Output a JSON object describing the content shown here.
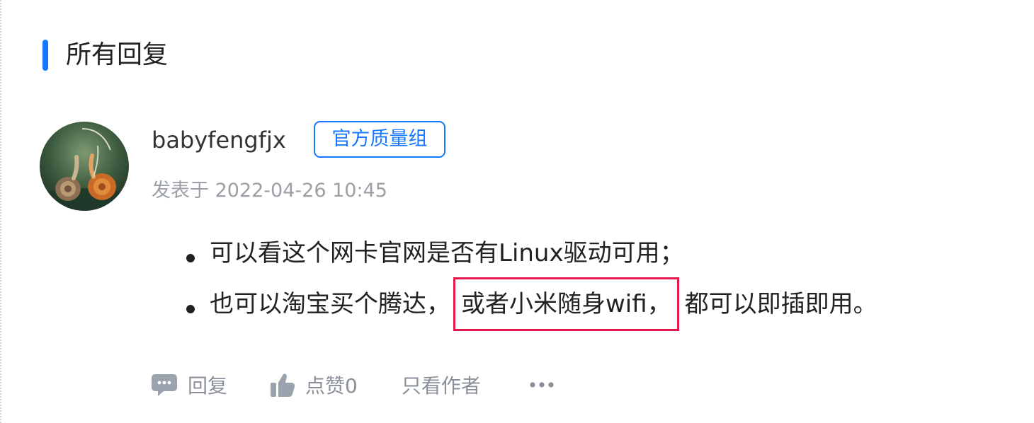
{
  "section": {
    "title": "所有回复",
    "accent_color": "#1677ff"
  },
  "reply": {
    "avatar_icon": "snail-avatar-icon",
    "username": "babyfengfjx",
    "badge": "官方质量组",
    "badge_color": "#1677ff",
    "timestamp": "发表于 2022-04-26 10:45",
    "content": [
      {
        "text": "可以看这个网卡官网是否有Linux驱动可用；"
      },
      {
        "text_before": "也可以淘宝买个腾达，",
        "highlighted_text": "或者小米随身wifi，",
        "text_after": "都可以即插即用。",
        "highlight_color": "#e8174b"
      }
    ],
    "actions": {
      "reply_label": "回复",
      "like_label": "点赞0",
      "author_only_label": "只看作者",
      "more_icon": "more-dots-icon"
    }
  }
}
